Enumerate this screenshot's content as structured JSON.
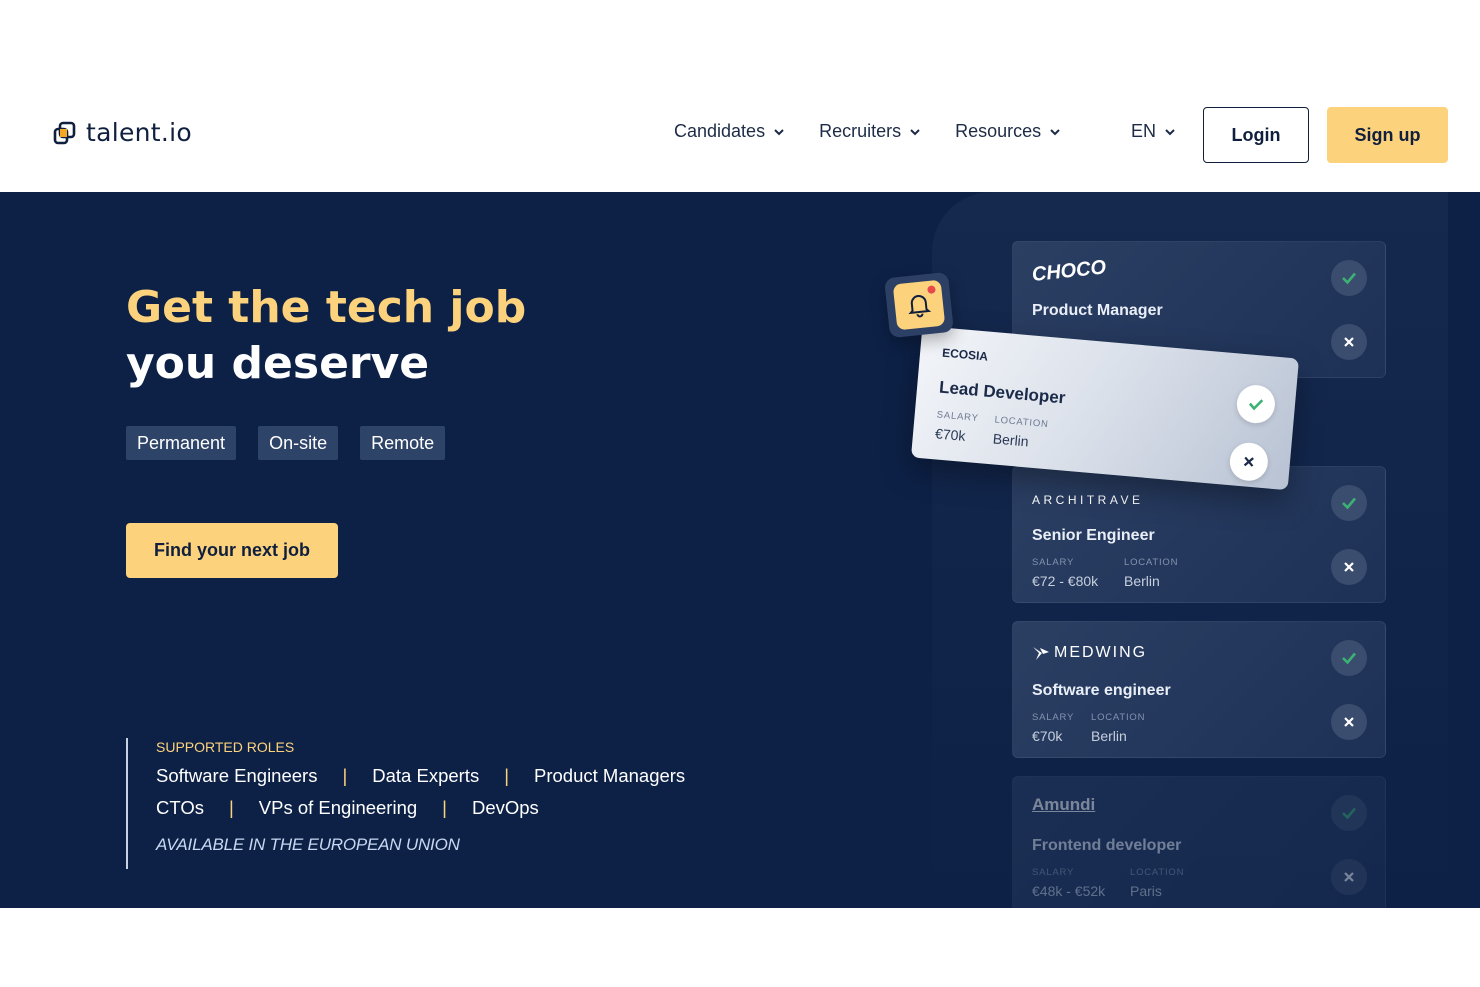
{
  "brand": {
    "name": "talent.io"
  },
  "nav": {
    "items": [
      {
        "label": "Candidates"
      },
      {
        "label": "Recruiters"
      },
      {
        "label": "Resources"
      }
    ],
    "language": "EN",
    "login": "Login",
    "signup": "Sign up"
  },
  "hero": {
    "title_line1": "Get the tech job",
    "title_line2": "you deserve",
    "tags": [
      "Permanent",
      "On-site",
      "Remote"
    ],
    "cta": "Find your next job",
    "roles_title": "SUPPORTED ROLES",
    "roles_row1": [
      "Software Engineers",
      "Data Experts",
      "Product Managers"
    ],
    "roles_row2": [
      "CTOs",
      "VPs of Engineering",
      "DevOps"
    ],
    "separator": "|",
    "availability": "AVAILABLE IN THE EUROPEAN UNION"
  },
  "cards": {
    "salary_label": "SALARY",
    "location_label": "LOCATION",
    "choco": {
      "company": "CHOCO",
      "role": "Product Manager"
    },
    "ecosia": {
      "company": "ECOSIA",
      "role": "Lead Developer",
      "salary": "€70k",
      "location": "Berlin"
    },
    "architrave": {
      "company": "ARCHITRAVE",
      "role": "Senior Engineer",
      "salary": "€72 - €80k",
      "location": "Berlin"
    },
    "medwing": {
      "company": "MEDWING",
      "role": "Software engineer",
      "salary": "€70k",
      "location": "Berlin"
    },
    "amundi": {
      "company": "Amundi",
      "role": "Frontend developer",
      "salary": "€48k - €52k",
      "location": "Paris"
    }
  },
  "colors": {
    "navy": "#0d2147",
    "accent": "#fdd27c",
    "tag_bg": "#2e4368",
    "check_green": "#3bb273"
  }
}
